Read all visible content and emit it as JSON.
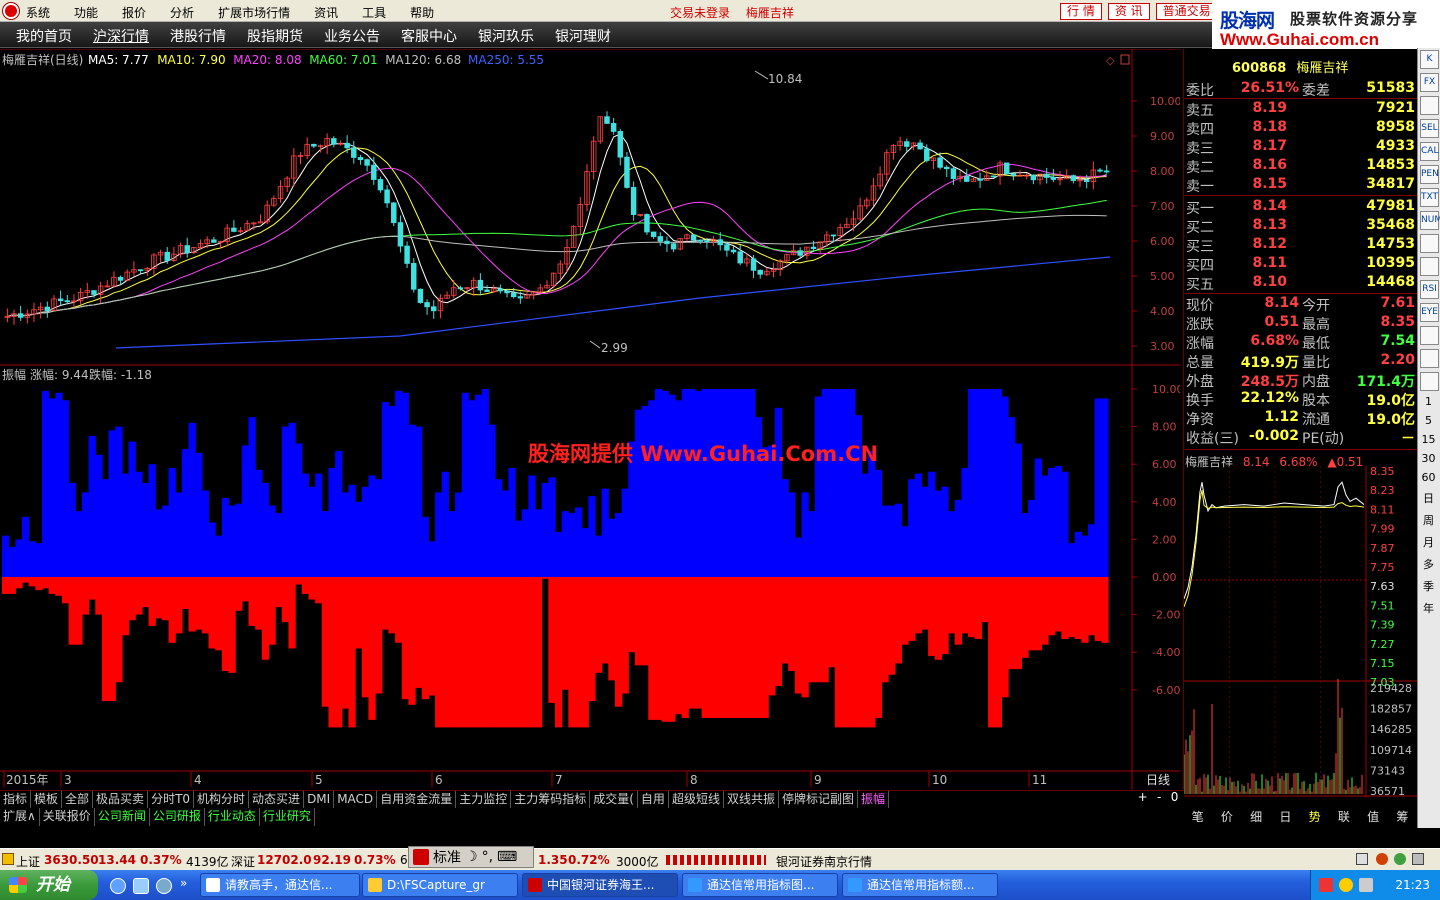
{
  "menubar": {
    "items": [
      "系统",
      "功能",
      "报价",
      "分析",
      "扩展市场行情",
      "资讯",
      "工具",
      "帮助"
    ],
    "status": [
      "交易未登录",
      "梅雁吉祥"
    ],
    "buttons": [
      "行 情",
      "资 讯",
      "普通交易"
    ]
  },
  "brand": {
    "name": "股海网",
    "slogan": "股票软件资源分享",
    "url": "Www.Guhai.com.cn"
  },
  "tabs": [
    "我的首页",
    "沪深行情",
    "港股行情",
    "股指期货",
    "业务公告",
    "客服中心",
    "银河玖乐",
    "银河理财"
  ],
  "active_tab": "沪深行情",
  "main_chart": {
    "title": "梅雁吉祥(日线)",
    "ma_labels": [
      {
        "text": "MA5: 7.77",
        "color": "#ffffff"
      },
      {
        "text": "MA10: 7.90",
        "color": "#ffff40"
      },
      {
        "text": "MA20: 8.08",
        "color": "#ff40ff"
      },
      {
        "text": "MA60: 7.01",
        "color": "#40ff40"
      },
      {
        "text": "MA120: 6.68",
        "color": "#c0c0c0"
      },
      {
        "text": "MA250: 5.55",
        "color": "#4060ff"
      }
    ],
    "high_label": "10.84",
    "low_label": "2.99",
    "y_ticks": [
      "10.00",
      "9.00",
      "8.00",
      "7.00",
      "6.00",
      "5.00",
      "4.00",
      "3.00"
    ]
  },
  "indicator": {
    "title": "振幅",
    "up_label": "涨幅: 9.44",
    "down_label": "跌幅: -1.18",
    "y_ticks": [
      "10.00",
      "8.00",
      "6.00",
      "4.00",
      "2.00",
      "0.00",
      "-2.00",
      "-4.00",
      "-6.00"
    ],
    "watermark": "股海网提供 Www.Guhai.Com.CN"
  },
  "x_axis": {
    "labels": [
      "2015年",
      "3",
      "4",
      "5",
      "6",
      "7",
      "8",
      "9",
      "10",
      "11"
    ],
    "period": "日线"
  },
  "chart_data": {
    "type": "bar",
    "title": "振幅",
    "up_series_name": "涨幅",
    "down_series_name": "跌幅",
    "ylim": [
      -8,
      10
    ],
    "up_values": [
      2.2,
      1.6,
      2.0,
      3.2,
      1.9,
      1.8,
      9.9,
      9.5,
      9.8,
      9.4,
      5.0,
      3.5,
      4.5,
      7.5,
      6.5,
      5.2,
      7.8,
      8.0,
      5.5,
      7.2,
      5.6,
      5.0,
      6.0,
      3.6,
      3.8,
      5.8,
      4.5,
      6.8,
      8.2,
      6.6,
      4.6,
      2.9,
      2.2,
      4.2,
      3.8,
      3.9,
      7.0,
      8.5,
      5.7,
      5.0,
      3.8,
      3.4,
      8.0,
      8.2,
      7.1,
      5.5,
      4.8,
      5.5,
      3.5,
      5.8,
      6.7,
      4.5,
      4.9,
      4.0,
      4.8,
      5.4,
      5.2,
      9.3,
      9.1,
      9.9,
      9.8,
      8.1,
      8.0,
      3.2,
      1.9,
      4.5,
      5.6,
      3.5,
      4.5,
      9.8,
      9.4,
      9.7,
      10.0,
      8.1,
      5.2,
      4.6,
      5.8,
      3.0,
      3.6,
      5.4,
      3.6,
      5.0,
      5.3,
      2.4,
      3.5,
      3.4,
      3.7,
      2.6,
      4.3,
      2.2,
      4.7,
      3.1,
      3.4,
      4.7,
      7.2,
      8.9,
      9.1,
      9.4,
      10.0,
      9.9,
      9.7,
      9.4,
      10.0,
      10.0,
      9.9,
      10.0,
      10.0,
      10.0,
      10.0,
      10.0,
      10.0,
      10.0,
      10.0,
      8.5,
      6.9,
      7.0,
      9.0,
      5.2,
      4.5,
      2.1,
      4.5,
      3.5,
      9.6,
      10.0,
      10.0,
      10.0,
      10.0,
      10.0,
      8.6,
      5.5,
      6.7,
      5.7,
      3.8,
      3.8,
      3.9,
      2.7,
      5.2,
      5.5,
      4.8,
      5.6,
      4.6,
      4.8,
      3.5,
      4.1,
      5.8,
      10.0,
      10.0,
      10.0,
      10.0,
      10.0,
      9.6,
      8.5,
      7.1,
      3.4,
      4.1,
      6.3,
      5.4,
      5.8,
      5.9,
      5.6,
      1.8,
      2.4,
      2.2,
      2.8,
      9.5,
      9.5
    ],
    "down_values": [
      -0.9,
      -0.9,
      -0.6,
      -0.3,
      -0.5,
      -0.7,
      -0.6,
      -0.9,
      -1.0,
      -1.4,
      -3.6,
      -3.6,
      -2.0,
      -1.2,
      -2.0,
      -6.6,
      -6.6,
      -5.6,
      -3.1,
      -2.3,
      -2.0,
      -1.6,
      -2.6,
      -2.2,
      -2.3,
      -3.5,
      -3.0,
      -1.7,
      -2.9,
      -2.8,
      -3.0,
      -3.8,
      -3.9,
      -5.0,
      -5.1,
      -1.8,
      -1.3,
      -2.6,
      -2.8,
      -4.4,
      -3.6,
      -1.6,
      -2.4,
      -3.8,
      -0.4,
      -0.9,
      -1.2,
      -1.4,
      -6.9,
      -8.0,
      -8.0,
      -7.0,
      -8.0,
      -3.8,
      -6.4,
      -7.6,
      -6.2,
      -2.8,
      -3.0,
      -3.5,
      -6.5,
      -6.8,
      -5.9,
      -6.5,
      -6.3,
      -8.0,
      -8.0,
      -8.0,
      -8.0,
      -8.0,
      -8.0,
      -8.0,
      -8.0,
      -8.0,
      -8.0,
      -8.0,
      -8.0,
      -8.0,
      -8.0,
      -8.0,
      -8.0,
      -0.1,
      -6.7,
      -8.0,
      -6.0,
      -8.0,
      -8.0,
      -8.0,
      -6.6,
      -5.1,
      -4.6,
      -5.5,
      -6.9,
      -6.2,
      -4.0,
      -4.7,
      -4.7,
      -7.6,
      -7.6,
      -7.7,
      -7.7,
      -7.3,
      -7.5,
      -7.0,
      -7.0,
      -7.5,
      -7.5,
      -7.5,
      -7.5,
      -7.5,
      -7.5,
      -7.5,
      -7.5,
      -7.5,
      -7.5,
      -6.3,
      -5.8,
      -4.6,
      -5.0,
      -6.2,
      -6.4,
      -5.6,
      -5.6,
      -5.6,
      -4.8,
      -8.0,
      -8.0,
      -8.0,
      -8.0,
      -8.0,
      -8.0,
      -7.5,
      -5.6,
      -5.2,
      -4.6,
      -3.6,
      -3.4,
      -3.0,
      -2.8,
      -4.2,
      -4.4,
      -4.1,
      -3.0,
      -3.6,
      -3.0,
      -3.2,
      -3.3,
      -2.4,
      -8.0,
      -8.0,
      -6.4,
      -4.9,
      -4.9,
      -4.3,
      -3.9,
      -3.9,
      -3.6,
      -3.1,
      -2.9,
      -3.3,
      -3.2,
      -3.3,
      -3.5,
      -3.1,
      -3.4,
      -3.5,
      -5.0,
      -5.0,
      -1.6,
      -1.6
    ]
  },
  "quote": {
    "code": "600868",
    "name": "梅雁吉祥",
    "webi_label": "委比",
    "webi": "26.51%",
    "weicha_label": "委差",
    "weicha": "51583",
    "asks": [
      {
        "label": "卖五",
        "price": "8.19",
        "vol": "7921"
      },
      {
        "label": "卖四",
        "price": "8.18",
        "vol": "8958"
      },
      {
        "label": "卖三",
        "price": "8.17",
        "vol": "4933"
      },
      {
        "label": "卖二",
        "price": "8.16",
        "vol": "14853"
      },
      {
        "label": "卖一",
        "price": "8.15",
        "vol": "34817"
      }
    ],
    "bids": [
      {
        "label": "买一",
        "price": "8.14",
        "vol": "47981"
      },
      {
        "label": "买二",
        "price": "8.13",
        "vol": "35468"
      },
      {
        "label": "买三",
        "price": "8.12",
        "vol": "14753"
      },
      {
        "label": "买四",
        "price": "8.11",
        "vol": "10395"
      },
      {
        "label": "买五",
        "price": "8.10",
        "vol": "14468"
      }
    ],
    "stats": [
      {
        "l1": "现价",
        "v1": "8.14",
        "l2": "今开",
        "v2": "7.61"
      },
      {
        "l1": "涨跌",
        "v1": "0.51",
        "l2": "最高",
        "v2": "8.35"
      },
      {
        "l1": "涨幅",
        "v1": "6.68%",
        "l2": "最低",
        "v2": "7.54"
      },
      {
        "l1": "总量",
        "v1": "419.9万",
        "l2": "量比",
        "v2": "2.20"
      },
      {
        "l1": "外盘",
        "v1": "248.5万",
        "l2": "内盘",
        "v2": "171.4万"
      },
      {
        "l1": "换手",
        "v1": "22.12%",
        "l2": "股本",
        "v2": "19.0亿"
      },
      {
        "l1": "净资",
        "v1": "1.12",
        "l2": "流通",
        "v2": "19.0亿"
      },
      {
        "l1": "收益(三)",
        "v1": "-0.002",
        "l2": "PE(动)",
        "v2": "－"
      }
    ]
  },
  "mini_chart": {
    "name": "梅雁吉祥",
    "price": "8.14",
    "pct": "6.68%",
    "chg": "▲0.51",
    "price_ticks": [
      "8.35",
      "8.23",
      "8.11",
      "7.99",
      "7.87",
      "7.75",
      "7.63",
      "7.51",
      "7.39",
      "7.27",
      "7.15",
      "7.03"
    ],
    "vol_ticks": [
      "219428",
      "182857",
      "146285",
      "109714",
      "73143",
      "36571"
    ]
  },
  "vtools": {
    "icons": [
      "K",
      "fx",
      "zoom",
      "sel",
      "cal",
      "pen",
      "txt",
      "num",
      "draw",
      "hist",
      "rsi",
      "eye",
      "move",
      "plus",
      "minus"
    ],
    "periods": [
      "1",
      "5",
      "15",
      "30",
      "60",
      "日",
      "周",
      "月",
      "多",
      "季",
      "年"
    ]
  },
  "bottom_tabs": [
    "指标",
    "模板",
    "全部",
    "极品买卖",
    "分时T0",
    "机构分时",
    "动态买进",
    "DMI",
    "MACD",
    "自用资金流量",
    "主力监控",
    "主力筹码指标",
    "成交量(",
    "自用",
    "超级短线",
    "双线共振",
    "停牌标记副图",
    "振幅"
  ],
  "bottom_active": "振幅",
  "bottom_ctrl": [
    "+",
    "-",
    "0"
  ],
  "info_tabs": [
    "扩展∧",
    "关联报价",
    "公司新闻",
    "公司研报",
    "行业动态",
    "行业研究"
  ],
  "side_tabs": [
    "笔",
    "价",
    "细",
    "日",
    "势",
    "联",
    "值",
    "筹"
  ],
  "side_active": "势",
  "status": {
    "sh_label": "上证",
    "sh": "3630.50",
    "sh_chg": "13.44",
    "sh_pct": "0.37%",
    "sh_amt": "4139亿",
    "sz_label": "深证",
    "sz": "12702.0",
    "sz_chg": "92.19",
    "sz_pct": "0.73%",
    "cy": "6",
    "cy_chg": "1.35",
    "cy_pct": "0.72%",
    "cy_amt": "3000亿",
    "broker": "银河证券南京行情",
    "float_label": "标准"
  },
  "taskbar": {
    "start": "开始",
    "tasks": [
      "请教高手，通达信...",
      "D:\\FSCapture_gr",
      "中国银河证券海王...",
      "通达信常用指标图...",
      "通达信常用指标额..."
    ],
    "clock": "21:23"
  }
}
